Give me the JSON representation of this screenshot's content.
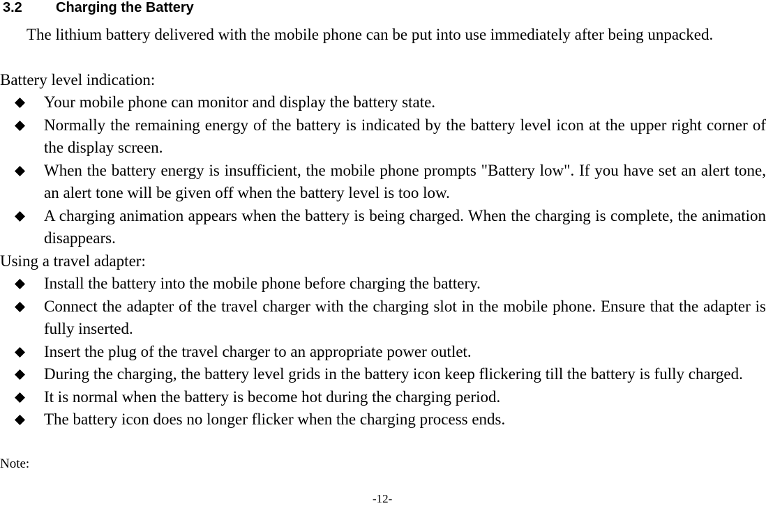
{
  "section": {
    "number": "3.2",
    "title": "Charging the Battery"
  },
  "intro": "The lithium battery delivered with the mobile phone can be put into use immediately after being unpacked.",
  "battery_level": {
    "label": "Battery level indication:",
    "bullets": [
      "Your mobile phone can monitor and display the battery state.",
      "Normally the remaining energy of the battery is indicated by the battery level icon at the upper right corner of the display screen.",
      "When the battery energy is insufficient, the mobile phone prompts \"Battery low\". If you have set an alert tone, an alert tone will be given off when the battery level is too low.",
      "A charging animation appears when the battery is being charged. When the charging is complete, the animation disappears."
    ]
  },
  "travel_adapter": {
    "label": "Using a travel adapter:",
    "bullets": [
      "Install the battery into the mobile phone before charging the battery.",
      "Connect the adapter of the travel charger with the charging slot in the mobile phone. Ensure that the adapter is fully inserted.",
      "Insert the plug of the travel charger to an appropriate power outlet.",
      "During the charging, the battery level grids in the battery icon keep flickering till the battery is fully charged.",
      "It is normal when the battery is become hot during the charging period.",
      "The battery icon does no longer flicker when the charging process ends."
    ]
  },
  "note_label": "Note:",
  "page_number": "-12-",
  "bullet_icon": "black-diamond"
}
